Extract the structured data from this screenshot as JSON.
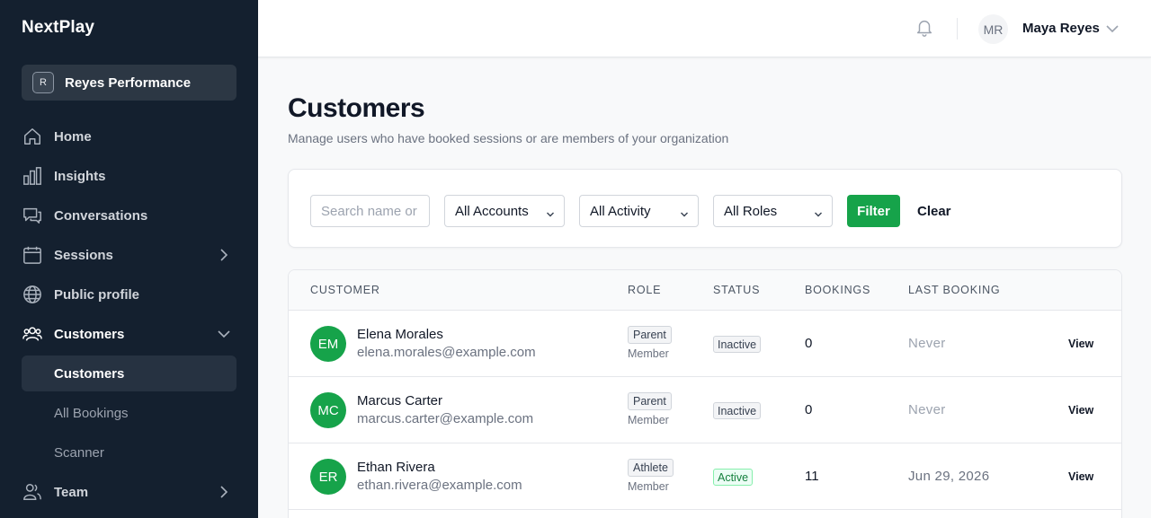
{
  "app": {
    "brand": "NextPlay"
  },
  "org": {
    "badge": "R",
    "name": "Reyes Performance"
  },
  "sidebar": {
    "items": [
      {
        "label": "Home"
      },
      {
        "label": "Insights"
      },
      {
        "label": "Conversations"
      },
      {
        "label": "Sessions"
      },
      {
        "label": "Public profile"
      },
      {
        "label": "Customers"
      },
      {
        "label": "Team"
      }
    ],
    "sub_items": [
      {
        "label": "Customers"
      },
      {
        "label": "All Bookings"
      },
      {
        "label": "Scanner"
      }
    ]
  },
  "header": {
    "user_initials": "MR",
    "user_name": "Maya Reyes"
  },
  "page": {
    "title": "Customers",
    "subtitle": "Manage users who have booked sessions or are members of your organization"
  },
  "filters": {
    "search_placeholder": "Search name or",
    "accounts": "All Accounts",
    "activity": "All Activity",
    "roles": "All Roles",
    "filter_label": "Filter",
    "clear_label": "Clear"
  },
  "table": {
    "headers": [
      "CUSTOMER",
      "ROLE",
      "STATUS",
      "BOOKINGS",
      "LAST BOOKING"
    ],
    "rows": [
      {
        "initials": "EM",
        "name": "Elena Morales",
        "email": "elena.morales@example.com",
        "role": "Parent",
        "role_sub": "Member",
        "status": "Inactive",
        "bookings": "0",
        "last": "Never",
        "action": "View"
      },
      {
        "initials": "MC",
        "name": "Marcus Carter",
        "email": "marcus.carter@example.com",
        "role": "Parent",
        "role_sub": "Member",
        "status": "Inactive",
        "bookings": "0",
        "last": "Never",
        "action": "View"
      },
      {
        "initials": "ER",
        "name": "Ethan Rivera",
        "email": "ethan.rivera@example.com",
        "role": "Athlete",
        "role_sub": "Member",
        "status": "Active",
        "bookings": "11",
        "last": "Jun 29, 2026",
        "action": "View"
      }
    ]
  },
  "colors": {
    "sidebar_bg": "#14202f",
    "accent_green": "#16a34a",
    "active_item_bg": "#263241"
  }
}
